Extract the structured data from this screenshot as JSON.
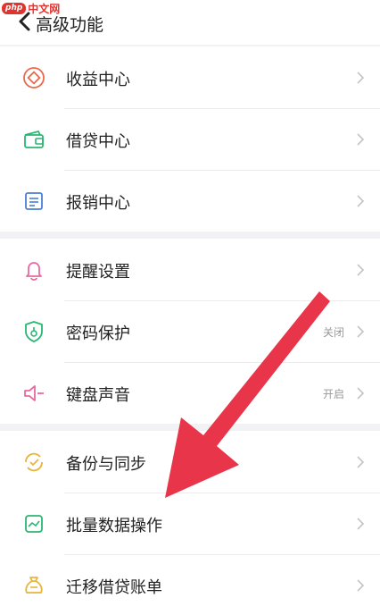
{
  "watermark": {
    "php": "php",
    "site": "中文网"
  },
  "header": {
    "title": "高级功能"
  },
  "groups": [
    {
      "items": [
        {
          "label": "收益中心",
          "icon": "coin-icon",
          "status": ""
        },
        {
          "label": "借贷中心",
          "icon": "wallet-icon",
          "status": ""
        },
        {
          "label": "报销中心",
          "icon": "receipt-icon",
          "status": ""
        }
      ]
    },
    {
      "items": [
        {
          "label": "提醒设置",
          "icon": "bell-icon",
          "status": ""
        },
        {
          "label": "密码保护",
          "icon": "shield-lock-icon",
          "status": "关闭"
        },
        {
          "label": "键盘声音",
          "icon": "speaker-icon",
          "status": "开启"
        }
      ]
    },
    {
      "items": [
        {
          "label": "备份与同步",
          "icon": "sync-check-icon",
          "status": ""
        },
        {
          "label": "批量数据操作",
          "icon": "chart-icon",
          "status": ""
        },
        {
          "label": "迁移借贷账单",
          "icon": "money-bag-icon",
          "status": ""
        }
      ]
    }
  ],
  "colors": {
    "accent_red": "#e8354a",
    "orange": "#e86a4a",
    "green": "#2bb673",
    "blue": "#4a7fd6",
    "pink": "#e86aa0",
    "yellow": "#e8b53a"
  }
}
